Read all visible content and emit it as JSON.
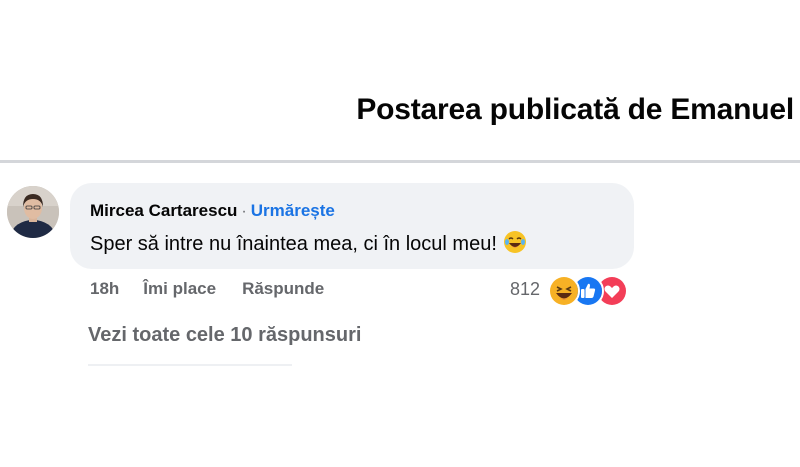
{
  "post": {
    "title": "Postarea publicată de Emanuel"
  },
  "comment": {
    "author": "Mircea Cartarescu",
    "separator": "·",
    "follow_label": "Urmărește",
    "text": "Sper să intre nu înaintea mea, ci în locul meu!",
    "text_emoji": "laughing-tears-icon",
    "time": "18h",
    "like_label": "Îmi place",
    "reply_label": "Răspunde",
    "reaction_count": "812",
    "reactions": [
      "haha-icon",
      "like-icon",
      "love-icon"
    ]
  },
  "replies": {
    "view_all_label": "Vezi toate cele 10 răspunsuri"
  },
  "colors": {
    "link_blue": "#1b74e4",
    "bubble_bg": "#f0f2f5",
    "secondary_text": "#65676b",
    "like_blue": "#1877f2",
    "love_red": "#f33e58",
    "haha_yellow": "#f7b125"
  }
}
